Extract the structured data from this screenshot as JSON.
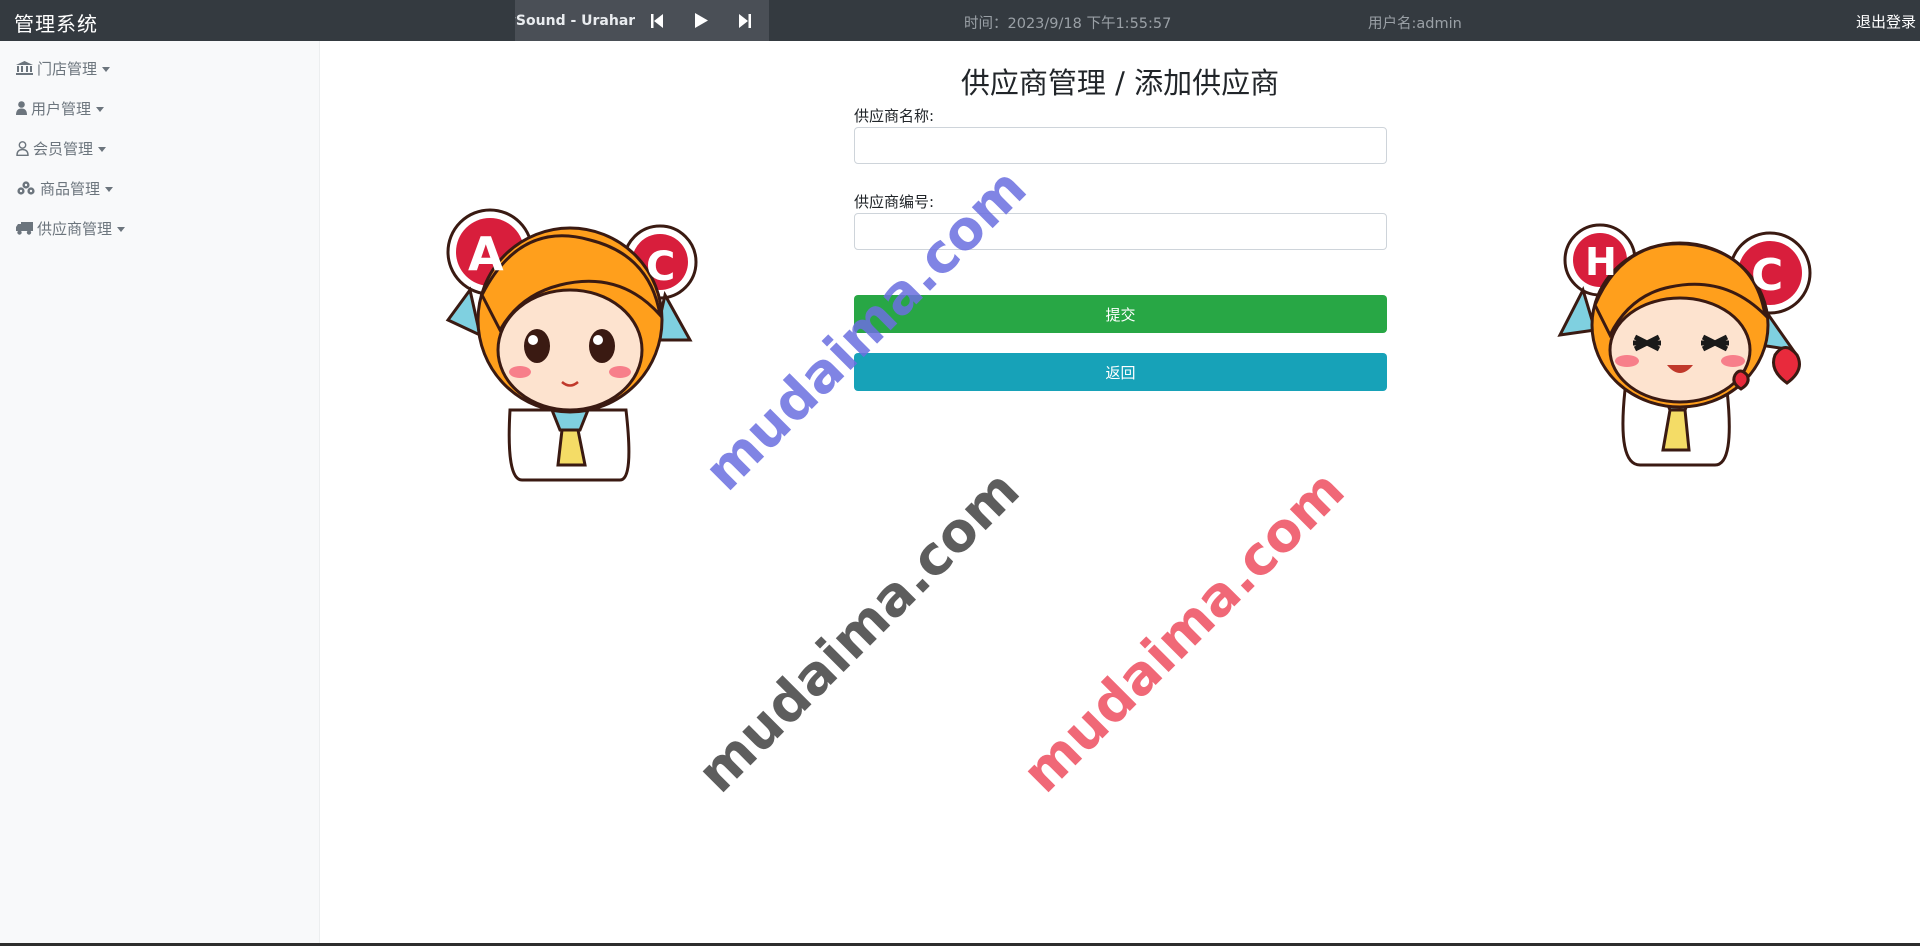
{
  "header": {
    "brand": "管理系统",
    "player": {
      "song": "wSound - Urahar"
    },
    "time_text": "时间：2023/9/18 下午1:55:57",
    "user_text": "用户名:admin",
    "logout_label": "退出登录"
  },
  "sidebar": {
    "items": [
      {
        "label": "门店管理",
        "icon": "bank-icon"
      },
      {
        "label": "用户管理",
        "icon": "user-icon"
      },
      {
        "label": "会员管理",
        "icon": "user-outline-icon"
      },
      {
        "label": "商品管理",
        "icon": "boxes-icon"
      },
      {
        "label": "供应商管理",
        "icon": "truck-icon"
      }
    ]
  },
  "form": {
    "title": "供应商管理 / 添加供应商",
    "name_label": "供应商名称:",
    "name_value": "",
    "code_label": "供应商编号:",
    "code_value": "",
    "submit_label": "提交",
    "back_label": "返回"
  },
  "watermarks": [
    "mudaima.com",
    "mudaima.com",
    "mudaima.com"
  ],
  "stickers": [
    {
      "name": "girl-sticker-left",
      "letters": "AC"
    },
    {
      "name": "girl-sticker-right",
      "letters": "HC"
    }
  ],
  "colors": {
    "navbar": "#343a40",
    "sidebar": "#f8f9fa",
    "submit": "#28a745",
    "back": "#17a2b8",
    "watermark_blue": "#6b6fe0",
    "watermark_gray": "#555555",
    "watermark_red": "#f06070"
  }
}
